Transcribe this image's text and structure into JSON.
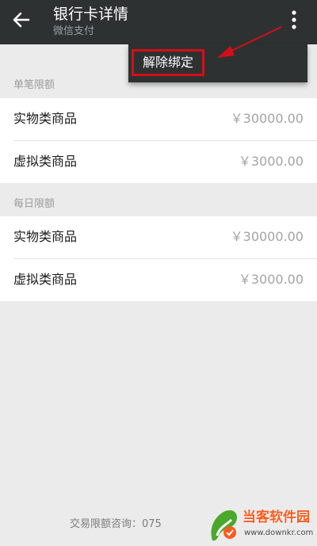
{
  "header": {
    "title": "银行卡详情",
    "subtitle": "微信支付",
    "back_icon": "arrow-left-icon",
    "more_icon": "more-vertical-icon"
  },
  "menu": {
    "items": [
      {
        "label": "解除绑定"
      }
    ],
    "highlight_color": "#d40f16"
  },
  "sections": [
    {
      "label": "单笔限额",
      "rows": [
        {
          "name": "实物类商品",
          "amount": "￥30000.00"
        },
        {
          "name": "虚拟类商品",
          "amount": "￥3000.00"
        }
      ]
    },
    {
      "label": "每日限额",
      "rows": [
        {
          "name": "实物类商品",
          "amount": "￥30000.00"
        },
        {
          "name": "虚拟类商品",
          "amount": "￥3000.00"
        }
      ]
    }
  ],
  "footer": {
    "text": "交易限额咨询：075"
  },
  "watermark": {
    "name": "当客软件园",
    "url": "www.downkr.com"
  },
  "colors": {
    "topbar": "#2e3132",
    "background": "#ebebeb",
    "annotation": "#d40f16",
    "watermark_brand": "#ff5a1f"
  }
}
